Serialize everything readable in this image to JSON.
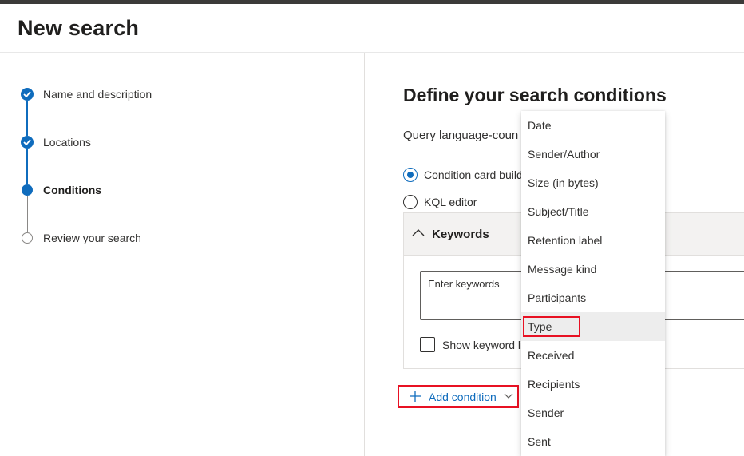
{
  "page": {
    "title": "New search"
  },
  "steps": [
    {
      "label": "Name and description",
      "state": "done"
    },
    {
      "label": "Locations",
      "state": "done"
    },
    {
      "label": "Conditions",
      "state": "current"
    },
    {
      "label": "Review your search",
      "state": "todo"
    }
  ],
  "main": {
    "heading": "Define your search conditions",
    "query_label": "Query language-coun",
    "radio_options": [
      {
        "label": "Condition card build",
        "selected": true
      },
      {
        "label": "KQL editor",
        "selected": false
      }
    ],
    "card": {
      "title": "Keywords",
      "input_placeholder": "Enter keywords",
      "checkbox_label": "Show keyword li"
    },
    "add_condition_label": "Add condition"
  },
  "dropdown": {
    "items": [
      "Date",
      "Sender/Author",
      "Size (in bytes)",
      "Subject/Title",
      "Retention label",
      "Message kind",
      "Participants",
      "Type",
      "Received",
      "Recipients",
      "Sender",
      "Sent"
    ],
    "hovered": "Type"
  },
  "colors": {
    "accent": "#0f6cbd",
    "highlight": "#e81123"
  }
}
